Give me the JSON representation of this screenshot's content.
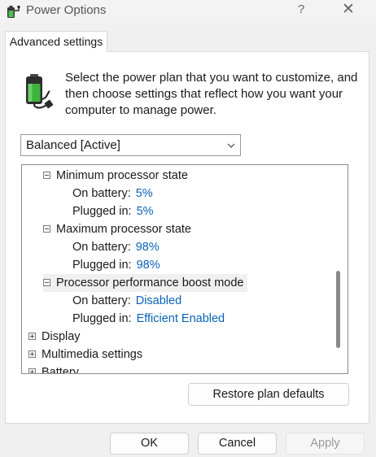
{
  "window": {
    "title": "Power Options",
    "help_glyph": "?",
    "close_glyph": "✕"
  },
  "tab": {
    "label": "Advanced settings"
  },
  "intro": {
    "text": "Select the power plan that you want to customize, and then choose settings that reflect how you want your computer to manage power."
  },
  "plan_select": {
    "selected": "Balanced [Active]"
  },
  "tree": {
    "rows": [
      {
        "label": "Minimum processor state",
        "toggle": "minus"
      },
      {
        "label": "On battery:",
        "value": "5%"
      },
      {
        "label": "Plugged in:",
        "value": "5%"
      },
      {
        "label": "Maximum processor state",
        "toggle": "minus"
      },
      {
        "label": "On battery:",
        "value": "98%"
      },
      {
        "label": "Plugged in:",
        "value": "98%"
      },
      {
        "label": "Processor performance boost mode",
        "toggle": "minus",
        "selected": true
      },
      {
        "label": "On battery:",
        "value": "Disabled"
      },
      {
        "label": "Plugged in:",
        "value": "Efficient Enabled"
      },
      {
        "label": "Display",
        "toggle": "plus"
      },
      {
        "label": "Multimedia settings",
        "toggle": "plus"
      },
      {
        "label": "Battery",
        "toggle": "plus"
      }
    ]
  },
  "buttons": {
    "restore": "Restore plan defaults",
    "ok": "OK",
    "cancel": "Cancel",
    "apply": "Apply"
  },
  "colors": {
    "value_link": "#0a62b8",
    "battery_green": "#3db33d"
  },
  "icons": {
    "app": "power-options-icon",
    "battery": "battery-plug-icon",
    "chevron": "chevron-down-icon",
    "help": "help-icon",
    "close": "close-icon"
  }
}
